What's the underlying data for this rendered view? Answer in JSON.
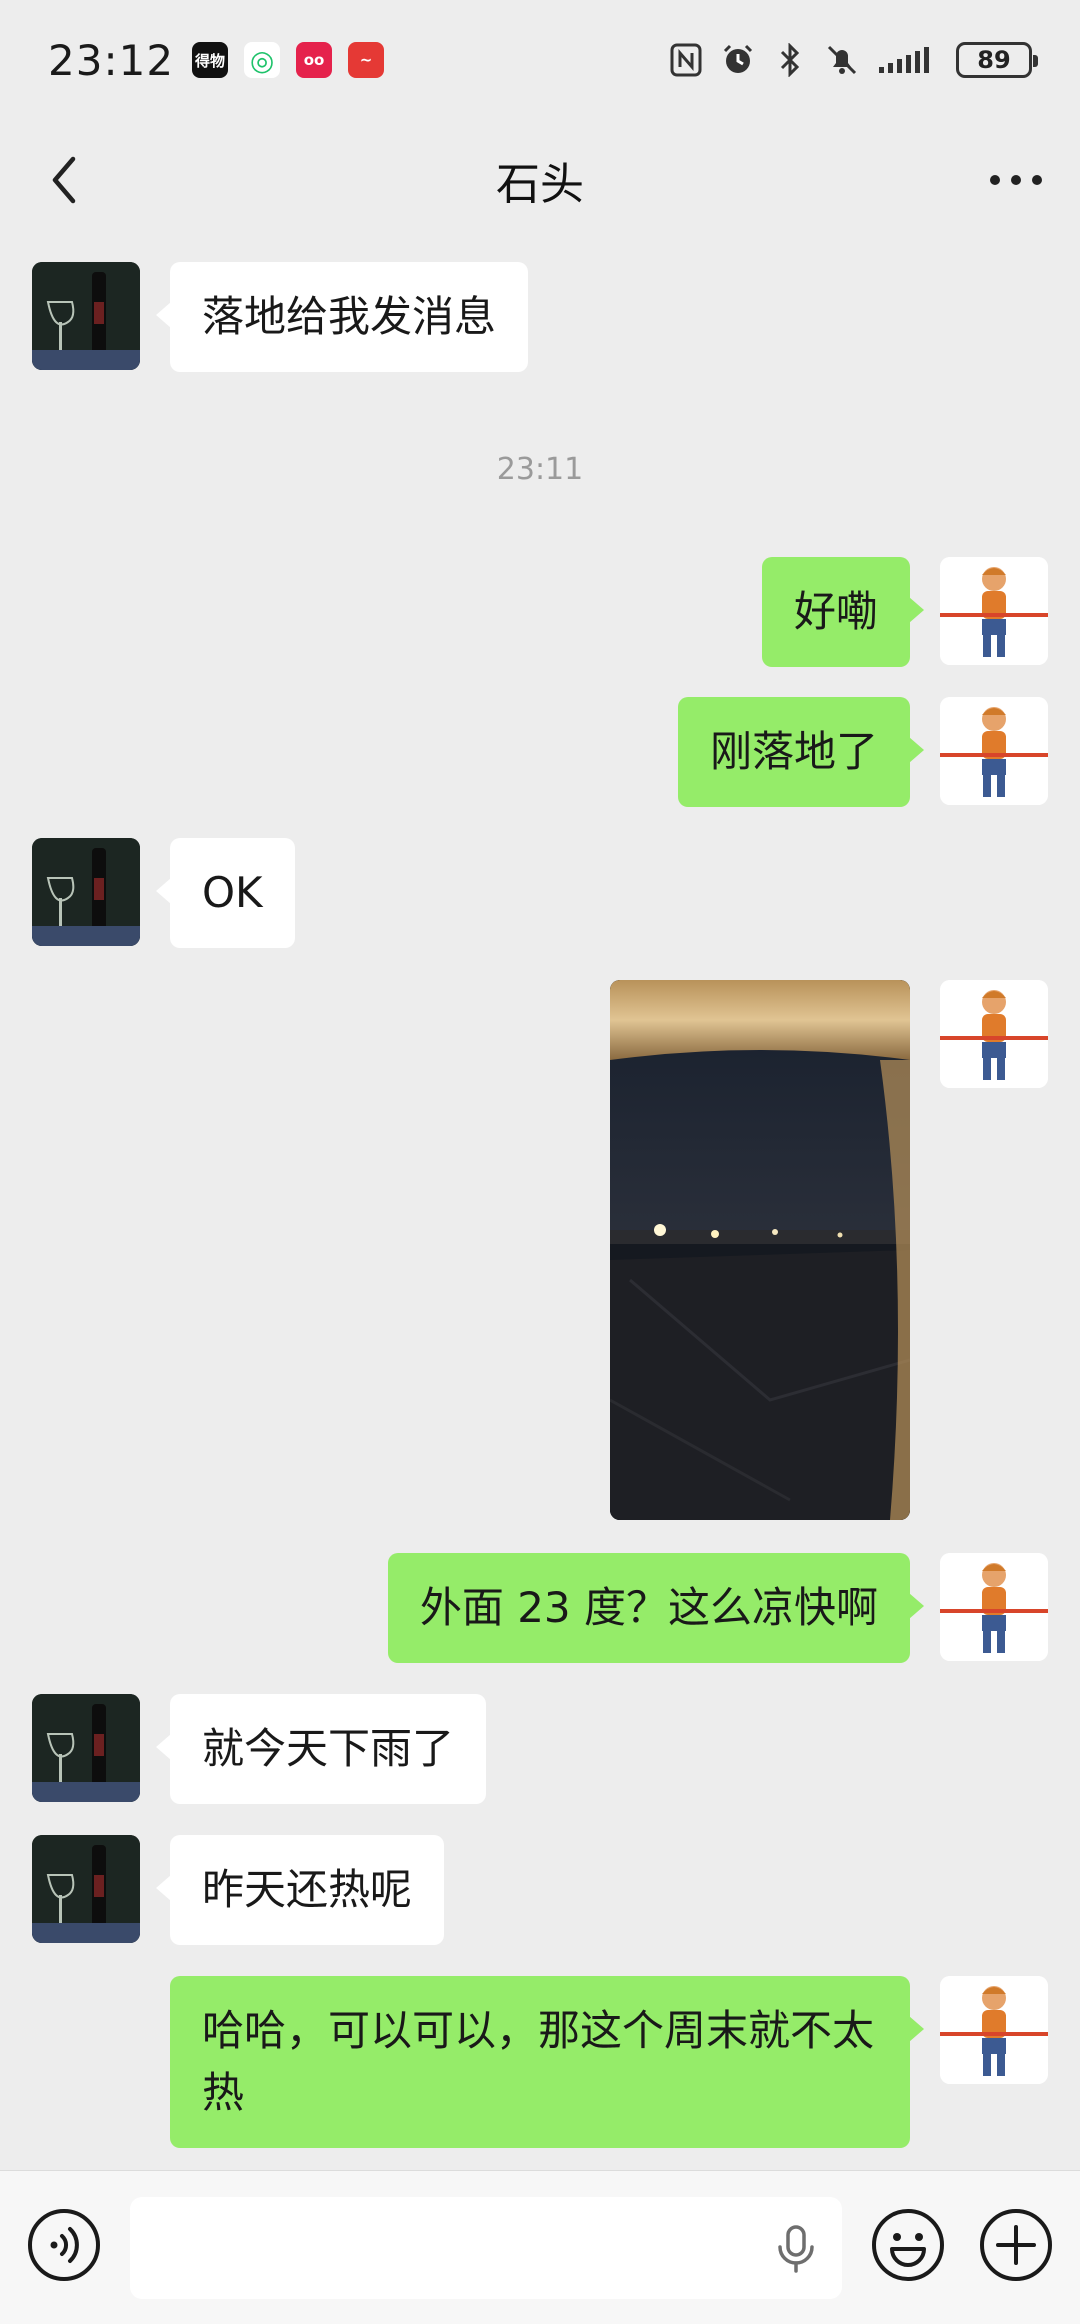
{
  "status_bar": {
    "time": "23:12",
    "apps": [
      {
        "name": "dewu-app-icon",
        "text": "得物",
        "color": "#111111"
      },
      {
        "name": "green-app-icon",
        "text": "◎",
        "color": "#1ec26a"
      },
      {
        "name": "pink-app-icon",
        "text": "oo",
        "color": "#e5224c"
      },
      {
        "name": "red-app-icon",
        "text": "~",
        "color": "#e53935"
      }
    ],
    "battery": "89"
  },
  "header": {
    "title": "石头"
  },
  "messages": [
    {
      "id": "m1",
      "side": "left",
      "text": "落地给我发消息"
    },
    {
      "id": "ts",
      "type": "timestamp",
      "text": "23:11"
    },
    {
      "id": "m2",
      "side": "right",
      "text": "好嘞"
    },
    {
      "id": "m3",
      "side": "right",
      "text": "刚落地了"
    },
    {
      "id": "m4",
      "side": "left",
      "text": "OK"
    },
    {
      "id": "m5",
      "side": "right",
      "type": "image"
    },
    {
      "id": "m6",
      "side": "right",
      "text": "外面 23 度？这么凉快啊"
    },
    {
      "id": "m7",
      "side": "left",
      "text": "就今天下雨了"
    },
    {
      "id": "m8",
      "side": "left",
      "text": "昨天还热呢"
    },
    {
      "id": "m9",
      "side": "right",
      "text": "哈哈，可以可以，那这个周末就不太热"
    }
  ],
  "colors": {
    "sent_bubble": "#95ec69",
    "received_bubble": "#ffffff",
    "background": "#ededed"
  }
}
